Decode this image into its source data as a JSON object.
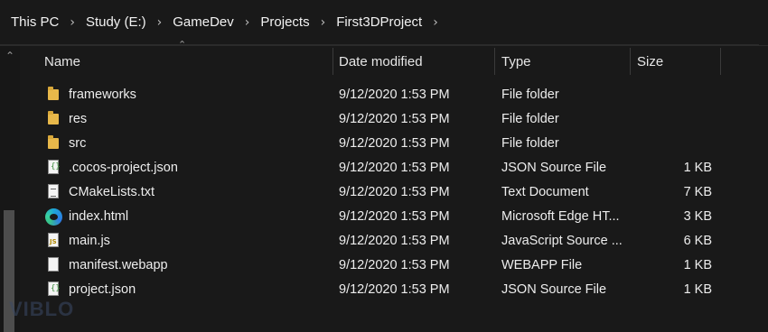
{
  "breadcrumb": {
    "items": [
      "This PC",
      "Study (E:)",
      "GameDev",
      "Projects",
      "First3DProject"
    ]
  },
  "columns": {
    "name": "Name",
    "date": "Date modified",
    "type": "Type",
    "size": "Size"
  },
  "files": [
    {
      "name": "frameworks",
      "date": "9/12/2020 1:53 PM",
      "type": "File folder",
      "size": "",
      "icon": "folder-icon"
    },
    {
      "name": "res",
      "date": "9/12/2020 1:53 PM",
      "type": "File folder",
      "size": "",
      "icon": "folder-icon"
    },
    {
      "name": "src",
      "date": "9/12/2020 1:53 PM",
      "type": "File folder",
      "size": "",
      "icon": "folder-icon"
    },
    {
      "name": ".cocos-project.json",
      "date": "9/12/2020 1:53 PM",
      "type": "JSON Source File",
      "size": "1 KB",
      "icon": "json-file-icon"
    },
    {
      "name": "CMakeLists.txt",
      "date": "9/12/2020 1:53 PM",
      "type": "Text Document",
      "size": "7 KB",
      "icon": "text-file-icon"
    },
    {
      "name": "index.html",
      "date": "9/12/2020 1:53 PM",
      "type": "Microsoft Edge HT...",
      "size": "3 KB",
      "icon": "edge-icon"
    },
    {
      "name": "main.js",
      "date": "9/12/2020 1:53 PM",
      "type": "JavaScript Source ...",
      "size": "6 KB",
      "icon": "js-file-icon"
    },
    {
      "name": "manifest.webapp",
      "date": "9/12/2020 1:53 PM",
      "type": "WEBAPP File",
      "size": "1 KB",
      "icon": "blank-file-icon"
    },
    {
      "name": "project.json",
      "date": "9/12/2020 1:53 PM",
      "type": "JSON Source File",
      "size": "1 KB",
      "icon": "json-file-icon"
    }
  ],
  "watermark": "VIBLO",
  "colors": {
    "background": "#191919",
    "folder": "#e8b84a",
    "text": "#ededed"
  }
}
